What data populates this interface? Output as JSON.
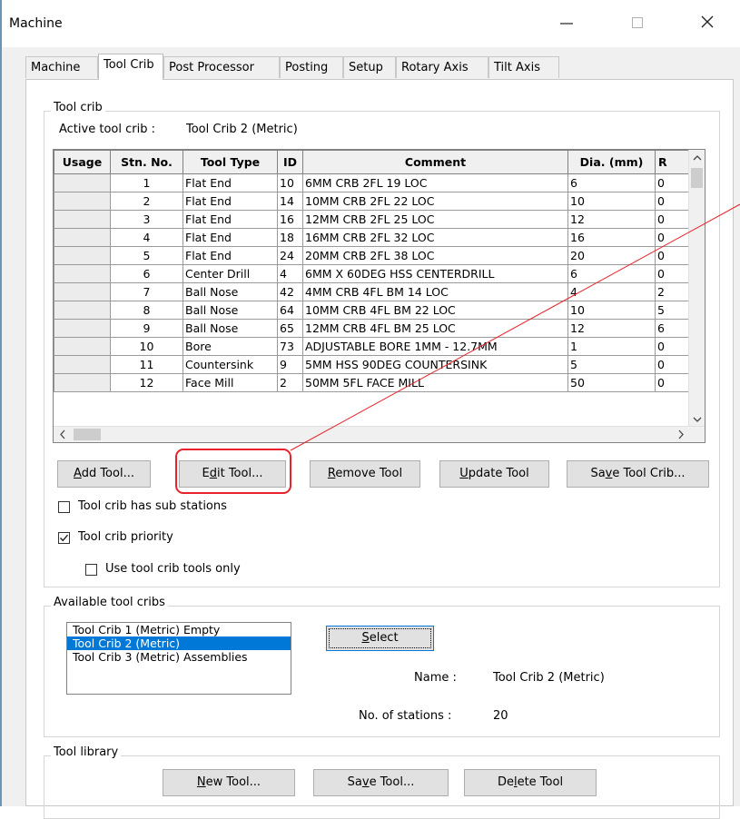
{
  "window": {
    "title": "Machine",
    "minimize_icon": "minimize-icon",
    "maximize_icon": "maximize-icon",
    "close_icon": "close-icon"
  },
  "tabs": [
    {
      "label": "Machine",
      "active": false
    },
    {
      "label": "Tool Crib",
      "active": true
    },
    {
      "label": "Post Processor",
      "active": false
    },
    {
      "label": "Posting",
      "active": false
    },
    {
      "label": "Setup",
      "active": false
    },
    {
      "label": "Rotary Axis",
      "active": false
    },
    {
      "label": "Tilt Axis",
      "active": false
    }
  ],
  "tool_crib": {
    "group_label": "Tool crib",
    "active_label": "Active tool crib :",
    "active_value": "Tool Crib 2 (Metric)",
    "columns": [
      "Usage",
      "Stn. No.",
      "Tool Type",
      "ID",
      "Comment",
      "Dia. (mm)",
      "R"
    ],
    "rows": [
      {
        "stn": "1",
        "type": "Flat End",
        "id": "10",
        "comment": "6MM CRB 2FL 19 LOC",
        "dia": "6",
        "r": "0"
      },
      {
        "stn": "2",
        "type": "Flat End",
        "id": "14",
        "comment": "10MM CRB 2FL 22 LOC",
        "dia": "10",
        "r": "0"
      },
      {
        "stn": "3",
        "type": "Flat End",
        "id": "16",
        "comment": "12MM CRB 2FL 25 LOC",
        "dia": "12",
        "r": "0"
      },
      {
        "stn": "4",
        "type": "Flat End",
        "id": "18",
        "comment": "16MM CRB 2FL 32 LOC",
        "dia": "16",
        "r": "0"
      },
      {
        "stn": "5",
        "type": "Flat End",
        "id": "24",
        "comment": "20MM CRB 2FL 38 LOC",
        "dia": "20",
        "r": "0"
      },
      {
        "stn": "6",
        "type": "Center Drill",
        "id": "4",
        "comment": "6MM X 60DEG HSS CENTERDRILL",
        "dia": "6",
        "r": "0"
      },
      {
        "stn": "7",
        "type": "Ball Nose",
        "id": "42",
        "comment": "4MM CRB 4FL BM 14 LOC",
        "dia": "4",
        "r": "2"
      },
      {
        "stn": "8",
        "type": "Ball Nose",
        "id": "64",
        "comment": "10MM CRB 4FL BM 22 LOC",
        "dia": "10",
        "r": "5"
      },
      {
        "stn": "9",
        "type": "Ball Nose",
        "id": "65",
        "comment": "12MM CRB 4FL BM 25 LOC",
        "dia": "12",
        "r": "6"
      },
      {
        "stn": "10",
        "type": "Bore",
        "id": "73",
        "comment": "ADJUSTABLE BORE 1MM - 12.7MM",
        "dia": "1",
        "r": "0"
      },
      {
        "stn": "11",
        "type": "Countersink",
        "id": "9",
        "comment": "5MM HSS 90DEG COUNTERSINK",
        "dia": "5",
        "r": "0"
      },
      {
        "stn": "12",
        "type": "Face Mill",
        "id": "2",
        "comment": "50MM 5FL FACE MILL",
        "dia": "50",
        "r": "0"
      }
    ],
    "buttons": {
      "add": {
        "pre": "",
        "key": "A",
        "post": "dd Tool..."
      },
      "edit": {
        "pre": "E",
        "key": "d",
        "post": "it Tool..."
      },
      "remove": {
        "pre": "",
        "key": "R",
        "post": "emove Tool"
      },
      "update": {
        "pre": "",
        "key": "U",
        "post": "pdate Tool"
      },
      "save_crib": {
        "pre": "Sa",
        "key": "v",
        "post": "e Tool Crib..."
      }
    },
    "checkboxes": {
      "sub_stations": {
        "label": "Tool crib has sub stations",
        "checked": false
      },
      "priority": {
        "label": "Tool crib priority",
        "checked": true
      },
      "use_only": {
        "label": "Use tool crib tools only",
        "checked": false
      }
    }
  },
  "available": {
    "group_label": "Available tool cribs",
    "items": [
      {
        "label": "Tool Crib 1 (Metric) Empty",
        "selected": false
      },
      {
        "label": "Tool Crib 2 (Metric)",
        "selected": true
      },
      {
        "label": "Tool Crib 3 (Metric) Assemblies",
        "selected": false
      }
    ],
    "select_button": {
      "pre": "",
      "key": "S",
      "post": "elect"
    },
    "name_label": "Name :",
    "name_value": "Tool Crib 2 (Metric)",
    "stations_label": "No. of stations :",
    "stations_value": "20"
  },
  "library": {
    "group_label": "Tool library",
    "buttons": {
      "new": {
        "pre": "",
        "key": "N",
        "post": "ew Tool..."
      },
      "save": {
        "pre": "Sa",
        "key": "v",
        "post": "e Tool..."
      },
      "delete": {
        "pre": "De",
        "key": "l",
        "post": "ete Tool"
      }
    }
  },
  "annotation_color": "#e8222a"
}
